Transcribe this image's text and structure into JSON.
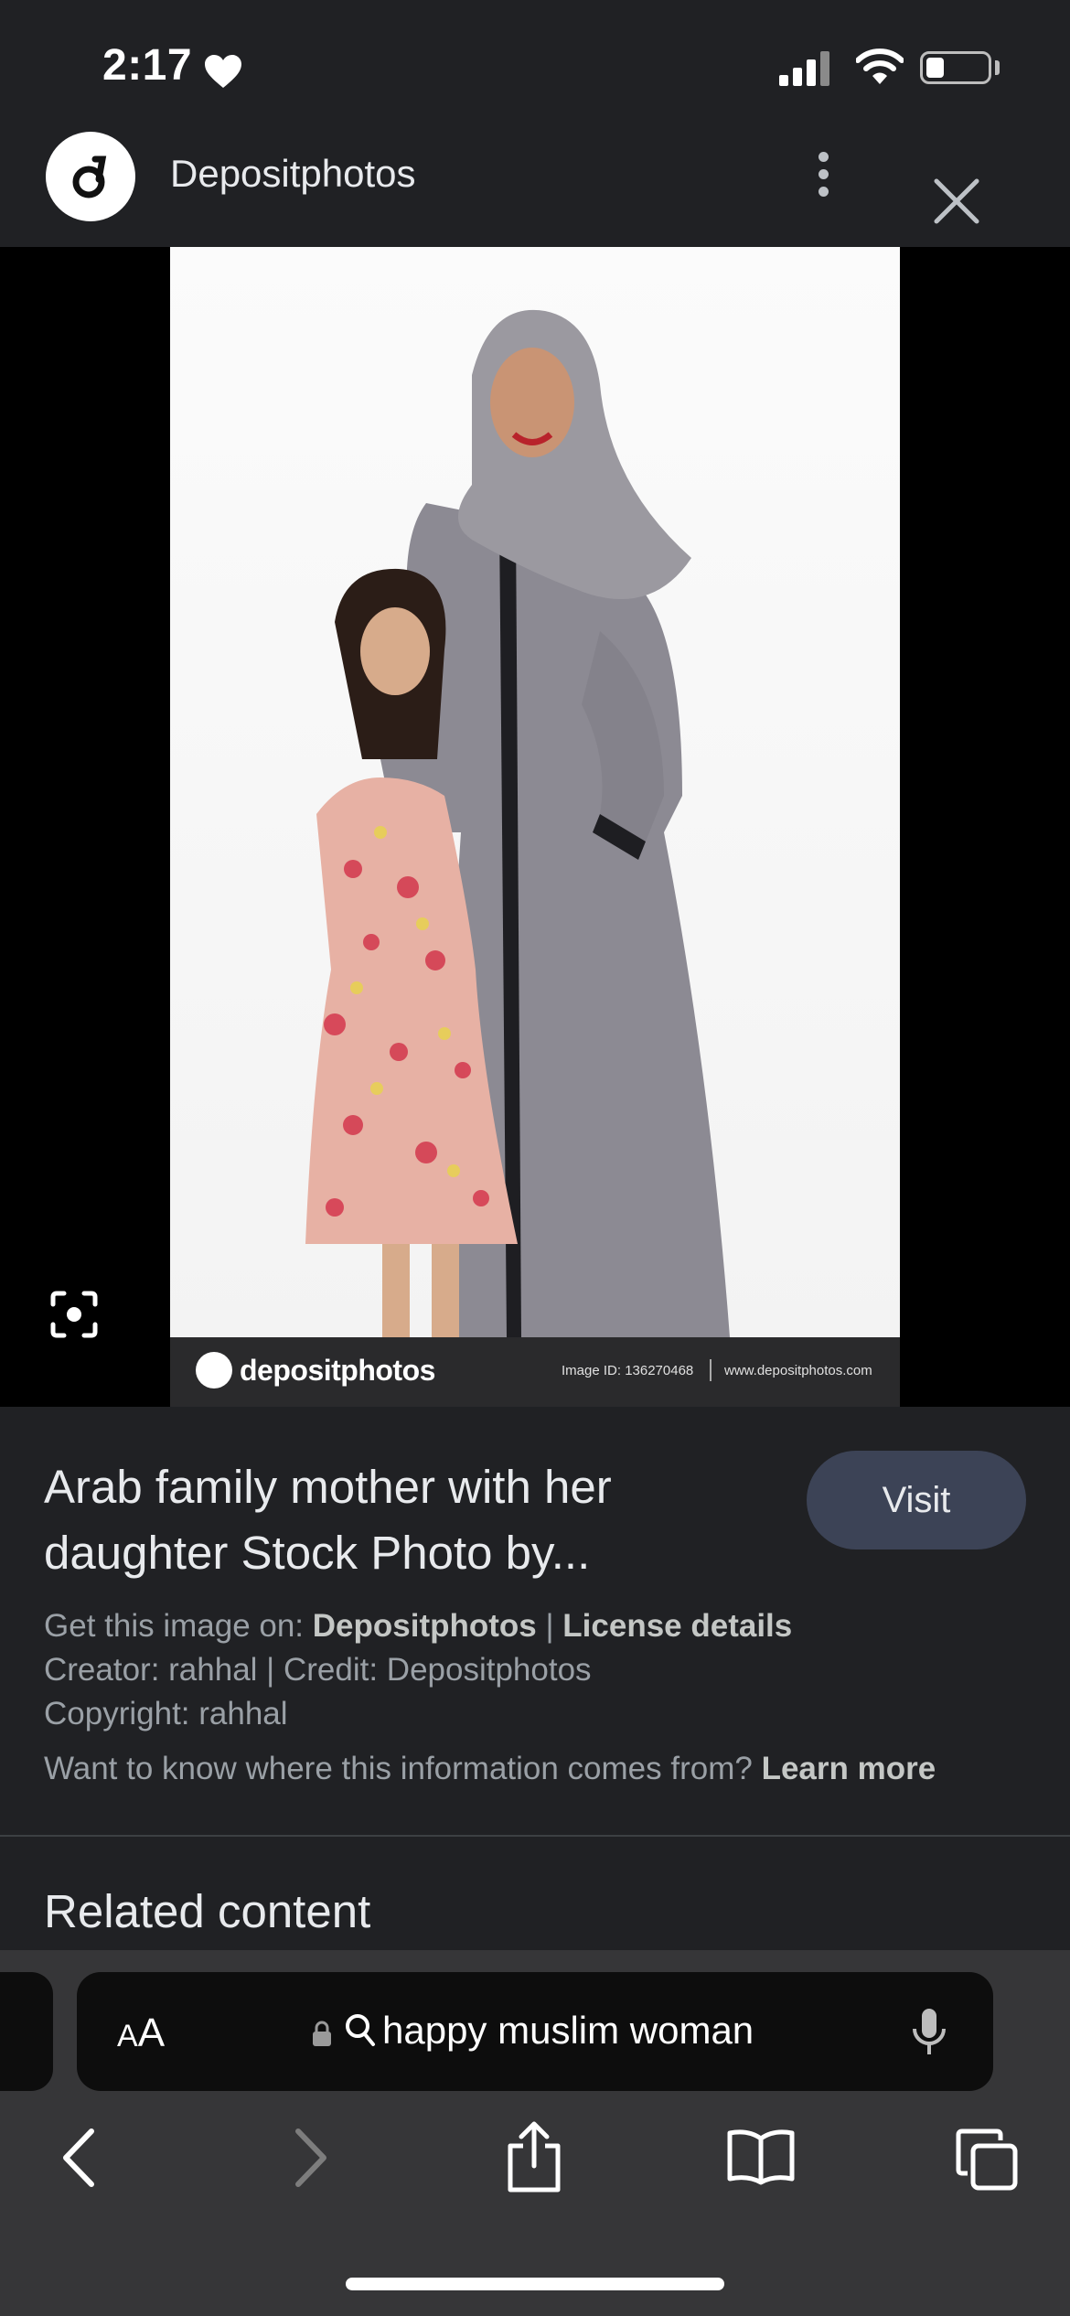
{
  "status_bar": {
    "time": "2:17",
    "battery_level": 0.3
  },
  "header": {
    "site_name": "Depositphotos",
    "logo_icon": "depositphotos-logo-icon"
  },
  "image": {
    "brand": "depositphotos",
    "image_id_text": "Image ID: 136270468",
    "site_url": "www.depositphotos.com"
  },
  "info": {
    "title": "Arab family mother with her daughter Stock Photo by...",
    "visit_label": "Visit",
    "get_prefix": "Get this image on: ",
    "get_source": "Depositphotos",
    "get_sep": " | ",
    "license_link": "License details",
    "creator_line": "Creator: rahhal | Credit: Depositphotos",
    "copyright_line": "Copyright: rahhal",
    "learn_prefix": "Want to know where this information comes from? ",
    "learn_link": "Learn more",
    "related_heading": "Related content"
  },
  "browser": {
    "aa_label_big": "A",
    "aa_label_small": "A",
    "search_query": "happy muslim woman"
  }
}
